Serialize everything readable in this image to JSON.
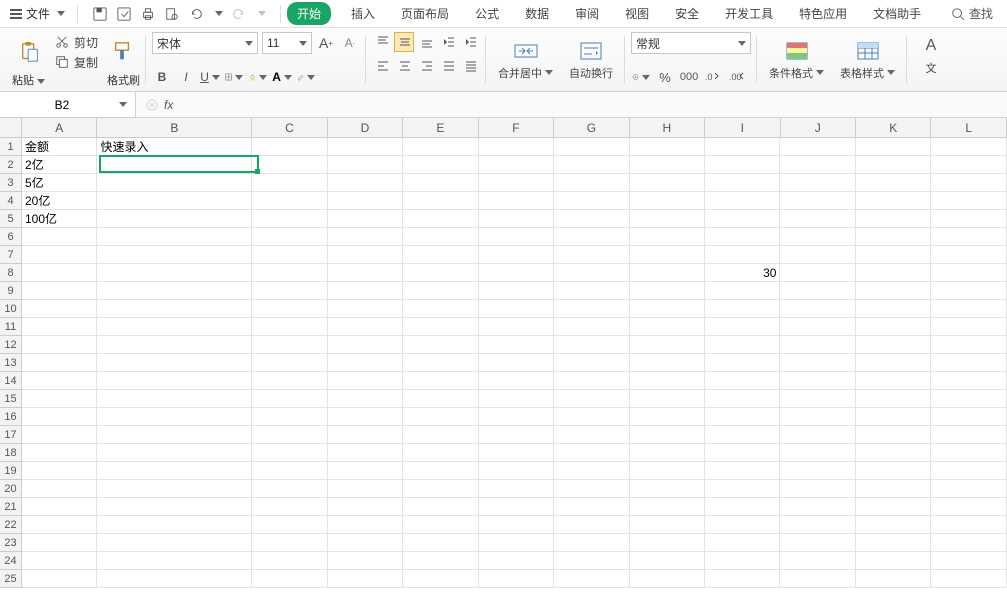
{
  "menu": {
    "file": "文件",
    "tabs": [
      "开始",
      "插入",
      "页面布局",
      "公式",
      "数据",
      "审阅",
      "视图",
      "安全",
      "开发工具",
      "特色应用",
      "文档助手"
    ],
    "active_tab_index": 0,
    "search": "查找"
  },
  "ribbon": {
    "paste": "粘贴",
    "cut": "剪切",
    "copy": "复制",
    "format_painter": "格式刷",
    "font_name": "宋体",
    "font_size": "11",
    "merge_center": "合并居中",
    "wrap_text": "自动换行",
    "number_format": "常规",
    "cond_format": "条件格式",
    "table_style": "表格样式",
    "text_group_partial": "文"
  },
  "formula_bar": {
    "name_box": "B2",
    "formula": ""
  },
  "grid": {
    "col_widths": {
      "A": 78,
      "B": 160,
      "default": 78
    },
    "columns": [
      "A",
      "B",
      "C",
      "D",
      "E",
      "F",
      "G",
      "H",
      "I",
      "J",
      "K",
      "L"
    ],
    "row_count": 25,
    "data": {
      "A1": "金额",
      "B1": "快速录入",
      "A2": "2亿",
      "A3": "5亿",
      "A4": "20亿",
      "A5": "100亿",
      "I8": "30"
    },
    "numeric_cells": [
      "I8"
    ],
    "active_cell": "B2"
  }
}
